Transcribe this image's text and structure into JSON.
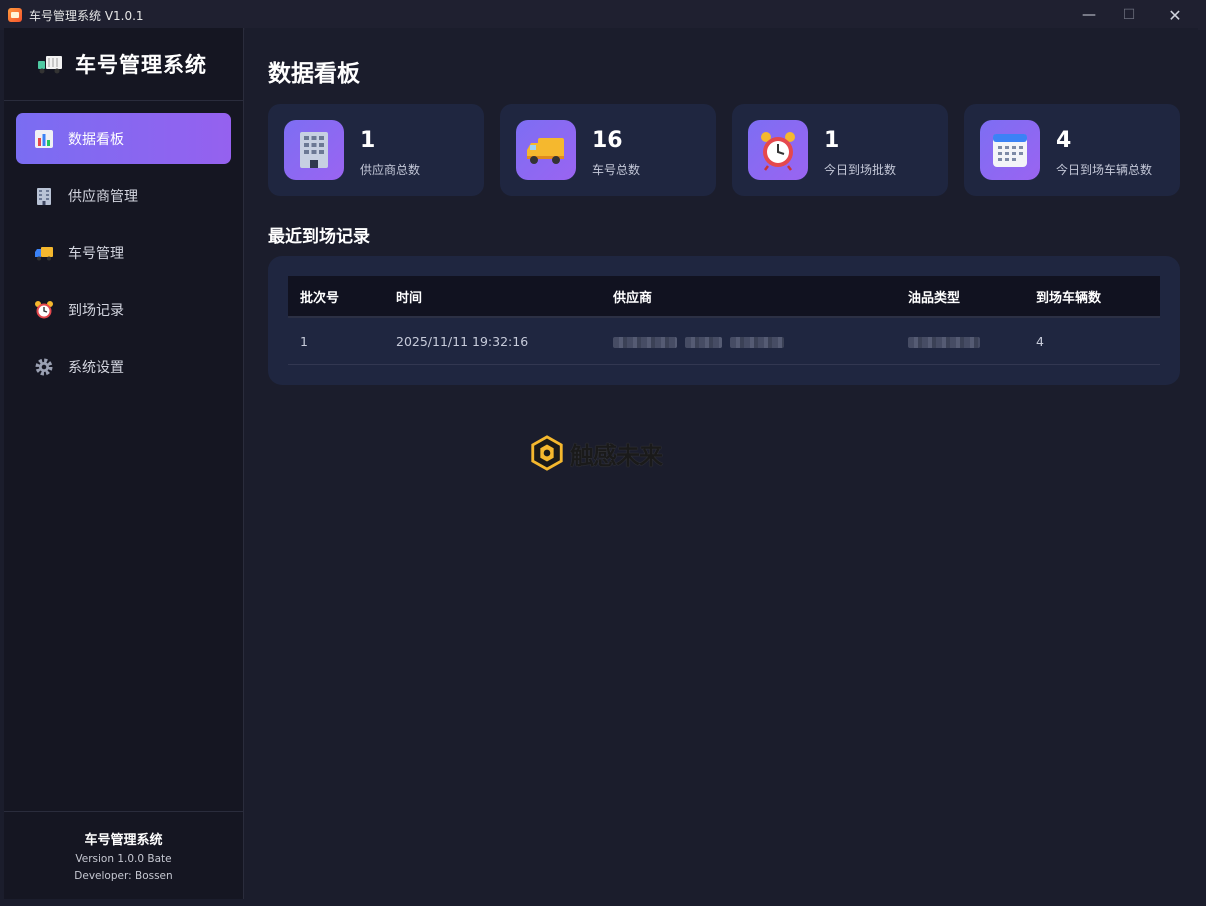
{
  "window": {
    "title": "车号管理系统 V1.0.1"
  },
  "sidebar": {
    "brand": "车号管理系统",
    "items": [
      {
        "label": "数据看板",
        "icon": "bar-chart-icon",
        "active": true
      },
      {
        "label": "供应商管理",
        "icon": "building-icon",
        "active": false
      },
      {
        "label": "车号管理",
        "icon": "truck-icon",
        "active": false
      },
      {
        "label": "到场记录",
        "icon": "alarm-clock-icon",
        "active": false
      },
      {
        "label": "系统设置",
        "icon": "gear-icon",
        "active": false
      }
    ],
    "footer": {
      "name": "车号管理系统",
      "version": "Version 1.0.0 Bate",
      "developer": "Developer: Bossen"
    }
  },
  "main": {
    "title": "数据看板",
    "cards": [
      {
        "value": "1",
        "label": "供应商总数",
        "icon": "building-icon"
      },
      {
        "value": "16",
        "label": "车号总数",
        "icon": "truck-icon"
      },
      {
        "value": "1",
        "label": "今日到场批数",
        "icon": "alarm-clock-icon"
      },
      {
        "value": "4",
        "label": "今日到场车辆总数",
        "icon": "calendar-icon"
      }
    ],
    "recent_title": "最近到场记录",
    "table": {
      "columns": [
        "批次号",
        "时间",
        "供应商",
        "油品类型",
        "到场车辆数"
      ],
      "rows": [
        {
          "batch": "1",
          "time": "2025/11/11 19:32:16",
          "supplier": "",
          "oil_type": "",
          "vehicles": "4"
        }
      ]
    }
  },
  "watermark": {
    "text": "触感未来"
  }
}
